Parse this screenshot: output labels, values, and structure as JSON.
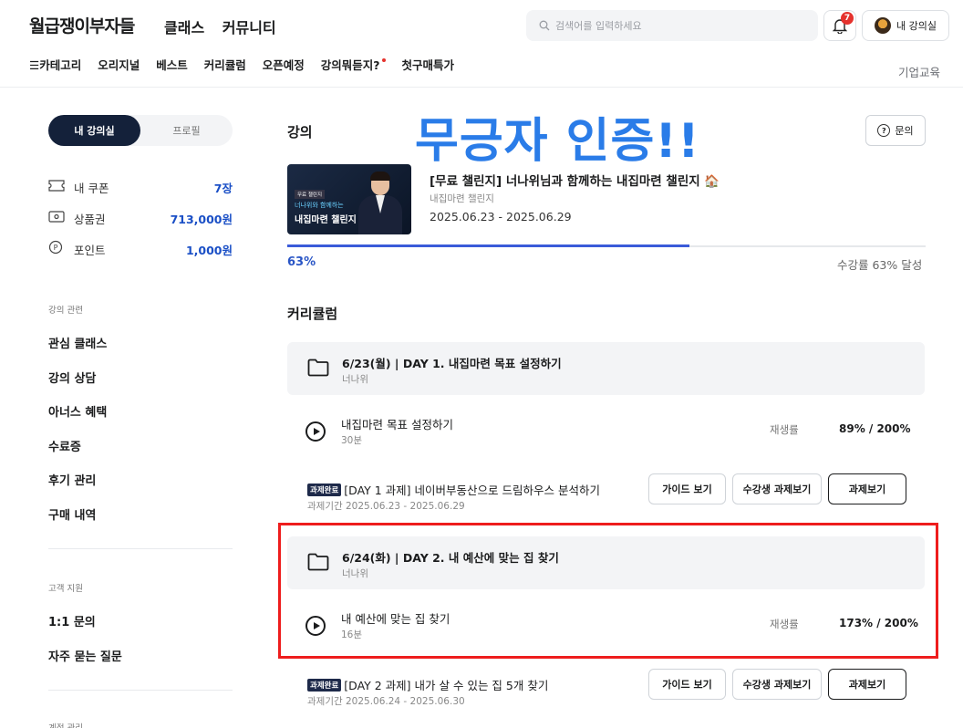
{
  "header": {
    "logo": "월급쟁이부자들",
    "nav": [
      "클래스",
      "커뮤니티"
    ],
    "search_placeholder": "검색어를 입력하세요",
    "notification_count": "7",
    "my_classroom": "내 강의실",
    "subnav": [
      "☰카테고리",
      "오리지널",
      "베스트",
      "커리큘럼",
      "오픈예정",
      "강의뭐듣지?",
      "첫구매특가"
    ],
    "corporate": "기업교육"
  },
  "sidebar": {
    "tabs": [
      "내 강의실",
      "프로필"
    ],
    "wallet": [
      {
        "label": "내 쿠폰",
        "value": "7장"
      },
      {
        "label": "상품권",
        "value": "713,000원"
      },
      {
        "label": "포인트",
        "value": "1,000원"
      }
    ],
    "section_course": "강의 관련",
    "course_menu": [
      "관심 클래스",
      "강의 상담",
      "아너스 혜택",
      "수료증",
      "후기 관리",
      "구매 내역"
    ],
    "section_support": "고객 지원",
    "support_menu": [
      "1:1 문의",
      "자주 묻는 질문"
    ],
    "section_account": "계정 관리"
  },
  "main": {
    "heading": "강의",
    "overlay_text": "무긍자 인증!!",
    "ask_button": "문의",
    "thumbnail": {
      "tag": "무료 챌린지",
      "sub": "너나위와 함께하는",
      "big": "내집마련 챌린지"
    },
    "course_title": "[무료 챌린지] 너나위님과 함께하는 내집마련 챌린지 🏠",
    "course_category": "내집마련 챌린지",
    "course_period": "2025.06.23 - 2025.06.29",
    "progress": 63,
    "progress_label": "63%",
    "progress_text": "수강률 63% 달성",
    "curriculum_heading": "커리큘럼",
    "days": [
      {
        "title": "6/23(월) | DAY 1. 내집마련 목표 설정하기",
        "instructor": "너나위",
        "lecture": {
          "title": "내집마련 목표 설정하기",
          "duration": "30분",
          "rate_label": "재생률",
          "rate": "89% / 200%"
        },
        "task": {
          "badge": "과제완료",
          "title": "[DAY 1 과제] 네이버부동산으로 드림하우스 분석하기",
          "period": "과제기간 2025.06.23 - 2025.06.29"
        }
      },
      {
        "title": "6/24(화) | DAY 2. 내 예산에 맞는 집 찾기",
        "instructor": "너나위",
        "lecture": {
          "title": "내 예산에 맞는 집 찾기",
          "duration": "16분",
          "rate_label": "재생률",
          "rate": "173% / 200%"
        },
        "task": {
          "badge": "과제완료",
          "title": "[DAY 2 과제] 내가 살 수 있는 집 5개 찾기",
          "period": "과제기간 2025.06.24 - 2025.06.30"
        }
      }
    ],
    "task_buttons": {
      "guide": "가이드 보기",
      "peer": "수강생 과제보기",
      "view": "과제보기"
    }
  },
  "colors": {
    "primary": "#14213a",
    "accent_blue": "#2a56c6",
    "overlay_blue": "#2a7ce8",
    "highlight_red": "#ee1d1d",
    "badge_red": "#e5322d"
  }
}
